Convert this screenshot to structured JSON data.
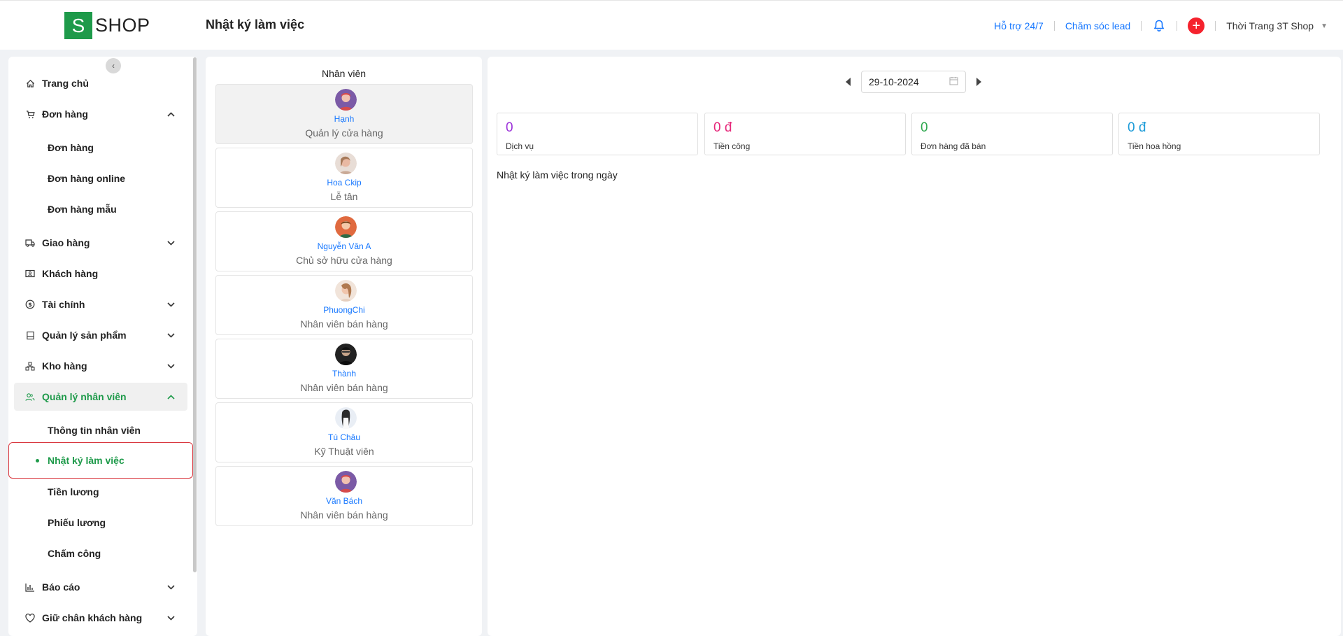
{
  "header": {
    "logo_letter": "S",
    "logo_text": "SHOP",
    "page_title": "Nhật ký làm việc",
    "support_link": "Hỗ trợ 24/7",
    "lead_link": "Chăm sóc lead",
    "shop_name": "Thời Trang 3T Shop"
  },
  "sidebar": {
    "items": [
      {
        "label": "Trang chủ"
      },
      {
        "label": "Đơn hàng"
      },
      {
        "label": "Đơn hàng"
      },
      {
        "label": "Đơn hàng online"
      },
      {
        "label": "Đơn hàng mẫu"
      },
      {
        "label": "Giao hàng"
      },
      {
        "label": "Khách hàng"
      },
      {
        "label": "Tài chính"
      },
      {
        "label": "Quản lý sản phẩm"
      },
      {
        "label": "Kho hàng"
      },
      {
        "label": "Quản lý nhân viên"
      },
      {
        "label": "Thông tin nhân viên"
      },
      {
        "label": "Nhật ký làm việc"
      },
      {
        "label": "Tiền lương"
      },
      {
        "label": "Phiếu lương"
      },
      {
        "label": "Chấm công"
      },
      {
        "label": "Báo cáo"
      },
      {
        "label": "Giữ chân khách hàng"
      }
    ]
  },
  "staff": {
    "title": "Nhân viên",
    "list": [
      {
        "name": "Hạnh",
        "role": "Quản lý cửa hàng"
      },
      {
        "name": "Hoa Ckip",
        "role": "Lễ tân"
      },
      {
        "name": "Nguyễn Văn A",
        "role": "Chủ sở hữu cửa hàng"
      },
      {
        "name": "PhuongChi",
        "role": "Nhân viên bán hàng"
      },
      {
        "name": "Thành",
        "role": "Nhân viên bán hàng"
      },
      {
        "name": "Tú Châu",
        "role": "Kỹ Thuật viên"
      },
      {
        "name": "Văn Bách",
        "role": "Nhân viên bán hàng"
      }
    ]
  },
  "main": {
    "date": "29-10-2024",
    "stats": [
      {
        "value": "0",
        "label": "Dịch vụ",
        "color": "#9b30d9"
      },
      {
        "value": "0 đ",
        "label": "Tiền công",
        "color": "#e6277a"
      },
      {
        "value": "0",
        "label": "Đơn hàng đã bán",
        "color": "#2fa84f"
      },
      {
        "value": "0 đ",
        "label": "Tiền hoa hồng",
        "color": "#1c9bd8"
      }
    ],
    "log_title": "Nhật ký làm việc trong ngày"
  },
  "colors": {
    "brand": "#1e9a4a",
    "link": "#1677ff",
    "danger": "#f5222d"
  }
}
